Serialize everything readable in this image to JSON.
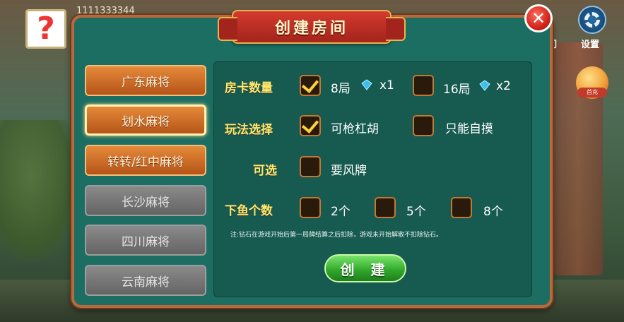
{
  "user": {
    "id": "1111333344"
  },
  "top_right": {
    "settings_label": "设置",
    "other_label": "们",
    "gift_label": "首充"
  },
  "dialog": {
    "title": "创建房间",
    "close_glyph": "✕",
    "tabs": [
      {
        "label": "广东麻将",
        "state": "enabled"
      },
      {
        "label": "划水麻将",
        "state": "selected"
      },
      {
        "label": "转转/红中麻将",
        "state": "enabled"
      },
      {
        "label": "长沙麻将",
        "state": "disabled"
      },
      {
        "label": "四川麻将",
        "state": "disabled"
      },
      {
        "label": "云南麻将",
        "state": "disabled"
      }
    ],
    "rows": {
      "room_cards": {
        "label": "房卡数量",
        "options": [
          {
            "text": "8局",
            "multiplier": "x1",
            "checked": true
          },
          {
            "text": "16局",
            "multiplier": "x2",
            "checked": false
          }
        ]
      },
      "play_mode": {
        "label": "玩法选择",
        "options": [
          {
            "text": "可枪杠胡",
            "checked": true
          },
          {
            "text": "只能自摸",
            "checked": false
          }
        ]
      },
      "optional": {
        "label": "可选",
        "options": [
          {
            "text": "要风牌",
            "checked": false
          }
        ]
      },
      "fish_count": {
        "label": "下鱼个数",
        "options": [
          {
            "text": "2个",
            "checked": false
          },
          {
            "text": "5个",
            "checked": false
          },
          {
            "text": "8个",
            "checked": false
          }
        ]
      }
    },
    "note": "注:钻石在游戏开始后第一局牌结算之后扣除，游戏未开始解散不扣除钻石。",
    "create_button": "创 建"
  },
  "colors": {
    "panel": "#1d6e62",
    "accent_label": "#ffe86a",
    "check": "#ffd23a",
    "create_button": "#2ea62a"
  }
}
